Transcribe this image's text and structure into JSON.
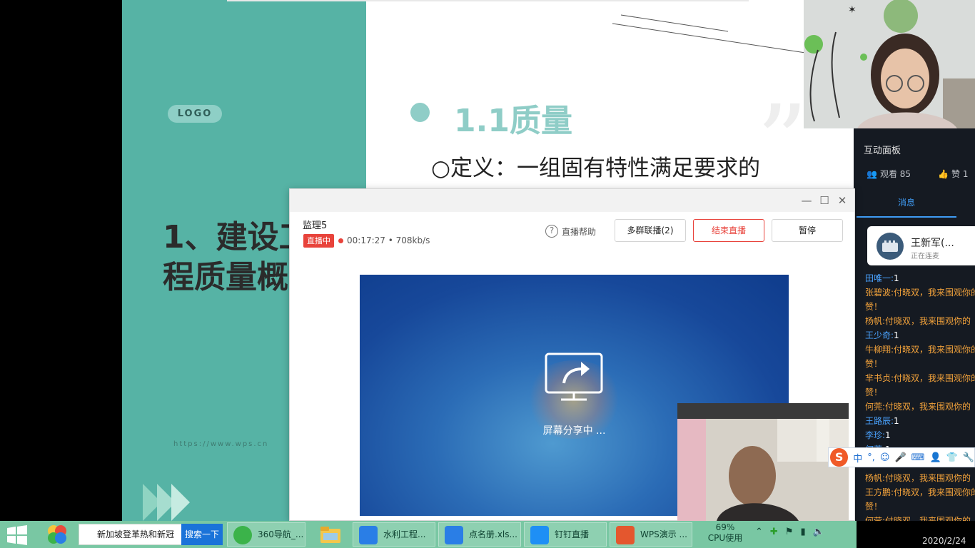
{
  "slide": {
    "logo": "LOGO",
    "title_line1": "1、建设工",
    "title_line2": "程质量概",
    "url": "https://www.wps.cn",
    "heading": "1.1质量",
    "definition": "○定义：一组固有特性满足要求的"
  },
  "live_window": {
    "name": "监理5",
    "status_badge": "直播中",
    "elapsed": "00:17:27",
    "bitrate": "708kb/s",
    "help_label": "直播帮助",
    "multi_group_label": "多群联播(2)",
    "end_label": "结束直播",
    "pause_label": "暂停",
    "sharing_text": "屏幕分享中 ...",
    "accent": "#e8433b"
  },
  "panel": {
    "title": "互动面板",
    "viewers_label": "观看 85",
    "likes_label": "赞 1",
    "tab_messages": "消息",
    "caller_name": "王新军(...",
    "caller_status": "正在连麦",
    "messages": [
      {
        "name": "田唯一:",
        "text": "1",
        "style": "b"
      },
      {
        "name": "张碧波:",
        "text": "付晓双，我来围观你的",
        "style": "y"
      },
      {
        "name": "",
        "text": "赞！",
        "style": "y"
      },
      {
        "name": "杨帆:",
        "text": "付晓双，我来围观你的",
        "style": "y"
      },
      {
        "name": "王少奇:",
        "text": "1",
        "style": "b"
      },
      {
        "name": "牛柳翔:",
        "text": "付晓双，我来围观你的",
        "style": "y"
      },
      {
        "name": "",
        "text": "赞！",
        "style": "y"
      },
      {
        "name": "芈书贞:",
        "text": "付晓双，我来围观你的",
        "style": "y"
      },
      {
        "name": "",
        "text": "赞！",
        "style": "y"
      },
      {
        "name": "何莞:",
        "text": "付晓双，我来围观你的",
        "style": "y"
      },
      {
        "name": "王路辰:",
        "text": "1",
        "style": "b"
      },
      {
        "name": "李珍:",
        "text": "1",
        "style": "b"
      },
      {
        "name": "何莞:",
        "text": "1",
        "style": "b"
      },
      {
        "name": "",
        "text": "",
        "style": "y"
      },
      {
        "name": "杨帆:",
        "text": "付晓双，我来围观你的",
        "style": "y"
      },
      {
        "name": "王方鹏:",
        "text": "付晓双，我来围观你的",
        "style": "y"
      },
      {
        "name": "",
        "text": "赞！",
        "style": "y"
      },
      {
        "name": "何莹:",
        "text": "付晓双，我来围观你的",
        "style": "y"
      }
    ]
  },
  "ime": {
    "logo": "S",
    "mode": "中",
    "punct": "°,"
  },
  "taskbar": {
    "search_value": "新加坡登革热和新冠",
    "search_button": "搜索一下",
    "tasks": [
      {
        "label": "360导航_...",
        "icon_color": "#3bb34a"
      },
      {
        "label": "水利工程...",
        "icon_color": "#2a7ee6"
      },
      {
        "label": "点名册.xls...",
        "icon_color": "#2a7ee6"
      },
      {
        "label": "钉钉直播",
        "icon_color": "#1e8ff5"
      },
      {
        "label": "WPS演示 ...",
        "icon_color": "#e4572e"
      }
    ],
    "cpu_percent": "69%",
    "cpu_label": "CPU使用",
    "clock_date": "2020/2/24"
  }
}
